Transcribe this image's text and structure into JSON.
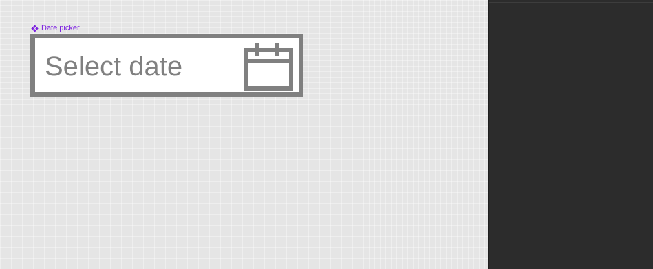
{
  "canvas": {
    "component_label": "Date picker",
    "component_icon": "component-icon"
  },
  "date_picker": {
    "placeholder": "Select date",
    "icon": "calendar-icon"
  },
  "colors": {
    "canvas_bg": "#e5e5e5",
    "panel_bg": "#2c2c2c",
    "component_accent": "#7b1fe0",
    "field_border": "#808080",
    "field_bg": "#ffffff",
    "placeholder_text": "#808080"
  }
}
